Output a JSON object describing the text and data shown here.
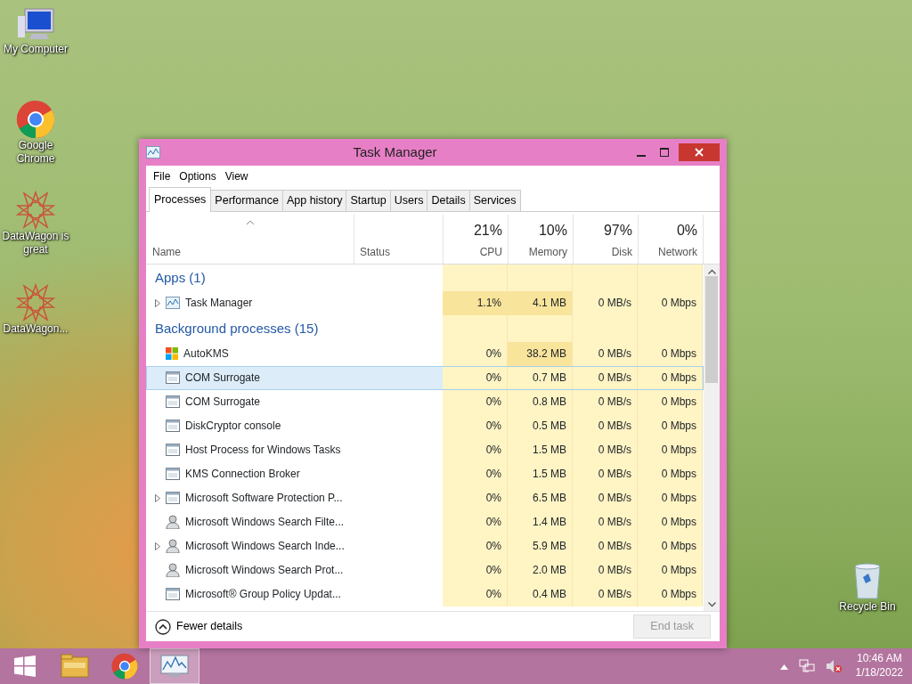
{
  "desktop_icons": [
    {
      "label": "My Computer",
      "kind": "computer"
    },
    {
      "label": "Google Chrome",
      "kind": "chrome"
    },
    {
      "label": "DataWagon is great",
      "kind": "star"
    },
    {
      "label": "DataWagon...",
      "kind": "star"
    },
    {
      "label": "Recycle Bin",
      "kind": "bin"
    }
  ],
  "window": {
    "title": "Task Manager",
    "menu": [
      "File",
      "Options",
      "View"
    ],
    "tabs": [
      {
        "label": "Processes",
        "selected": true
      },
      {
        "label": "Performance",
        "selected": false
      },
      {
        "label": "App history",
        "selected": false
      },
      {
        "label": "Startup",
        "selected": false
      },
      {
        "label": "Users",
        "selected": false
      },
      {
        "label": "Details",
        "selected": false
      },
      {
        "label": "Services",
        "selected": false
      }
    ],
    "columns": [
      {
        "label": "Name"
      },
      {
        "label": "Status"
      },
      {
        "label": "CPU",
        "summary": "21%"
      },
      {
        "label": "Memory",
        "summary": "10%"
      },
      {
        "label": "Disk",
        "summary": "97%"
      },
      {
        "label": "Network",
        "summary": "0%"
      }
    ],
    "rows": [
      {
        "kind": "group",
        "name": "Apps (1)"
      },
      {
        "kind": "chart",
        "name": "Task Manager",
        "expandable": true,
        "selected": false,
        "cpu": "1.1%",
        "memory": "4.1 MB",
        "disk": "0 MB/s",
        "network": "0 Mbps",
        "cpu_hot": true,
        "memory_hot": true
      },
      {
        "kind": "group",
        "name": "Background processes (15)"
      },
      {
        "kind": "tiles",
        "name": "AutoKMS",
        "expandable": false,
        "selected": false,
        "cpu": "0%",
        "memory": "38.2 MB",
        "disk": "0 MB/s",
        "network": "0 Mbps",
        "cpu_hot": false,
        "memory_hot": true
      },
      {
        "kind": "window",
        "name": "COM Surrogate",
        "expandable": false,
        "selected": true,
        "cpu": "0%",
        "memory": "0.7 MB",
        "disk": "0 MB/s",
        "network": "0 Mbps",
        "cpu_hot": false,
        "memory_hot": false
      },
      {
        "kind": "window",
        "name": "COM Surrogate",
        "expandable": false,
        "selected": false,
        "cpu": "0%",
        "memory": "0.8 MB",
        "disk": "0 MB/s",
        "network": "0 Mbps",
        "cpu_hot": false,
        "memory_hot": false
      },
      {
        "kind": "window",
        "name": "DiskCryptor console",
        "expandable": false,
        "selected": false,
        "cpu": "0%",
        "memory": "0.5 MB",
        "disk": "0 MB/s",
        "network": "0 Mbps",
        "cpu_hot": false,
        "memory_hot": false
      },
      {
        "kind": "window",
        "name": "Host Process for Windows Tasks",
        "expandable": false,
        "selected": false,
        "cpu": "0%",
        "memory": "1.5 MB",
        "disk": "0 MB/s",
        "network": "0 Mbps",
        "cpu_hot": false,
        "memory_hot": false
      },
      {
        "kind": "window",
        "name": "KMS Connection Broker",
        "expandable": false,
        "selected": false,
        "cpu": "0%",
        "memory": "1.5 MB",
        "disk": "0 MB/s",
        "network": "0 Mbps",
        "cpu_hot": false,
        "memory_hot": false
      },
      {
        "kind": "window",
        "name": "Microsoft Software Protection P...",
        "expandable": true,
        "selected": false,
        "cpu": "0%",
        "memory": "6.5 MB",
        "disk": "0 MB/s",
        "network": "0 Mbps",
        "cpu_hot": false,
        "memory_hot": false
      },
      {
        "kind": "person",
        "name": "Microsoft Windows Search Filte...",
        "expandable": false,
        "selected": false,
        "cpu": "0%",
        "memory": "1.4 MB",
        "disk": "0 MB/s",
        "network": "0 Mbps",
        "cpu_hot": false,
        "memory_hot": false
      },
      {
        "kind": "person",
        "name": "Microsoft Windows Search Inde...",
        "expandable": true,
        "selected": false,
        "cpu": "0%",
        "memory": "5.9 MB",
        "disk": "0 MB/s",
        "network": "0 Mbps",
        "cpu_hot": false,
        "memory_hot": false
      },
      {
        "kind": "person",
        "name": "Microsoft Windows Search Prot...",
        "expandable": false,
        "selected": false,
        "cpu": "0%",
        "memory": "2.0 MB",
        "disk": "0 MB/s",
        "network": "0 Mbps",
        "cpu_hot": false,
        "memory_hot": false
      },
      {
        "kind": "window",
        "name": "Microsoft® Group Policy Updat...",
        "expandable": false,
        "selected": false,
        "cpu": "0%",
        "memory": "0.4 MB",
        "disk": "0 MB/s",
        "network": "0 Mbps",
        "cpu_hot": false,
        "memory_hot": false
      }
    ],
    "fewer_details": "Fewer details",
    "end_task": {
      "label": "End task",
      "disabled": true
    }
  },
  "taskbar": {
    "apps": [
      {
        "kind": "explorer",
        "active": false
      },
      {
        "kind": "chrome",
        "active": false
      },
      {
        "kind": "taskmgr",
        "active": true
      }
    ],
    "time": "10:46 AM",
    "date": "1/18/2022"
  }
}
